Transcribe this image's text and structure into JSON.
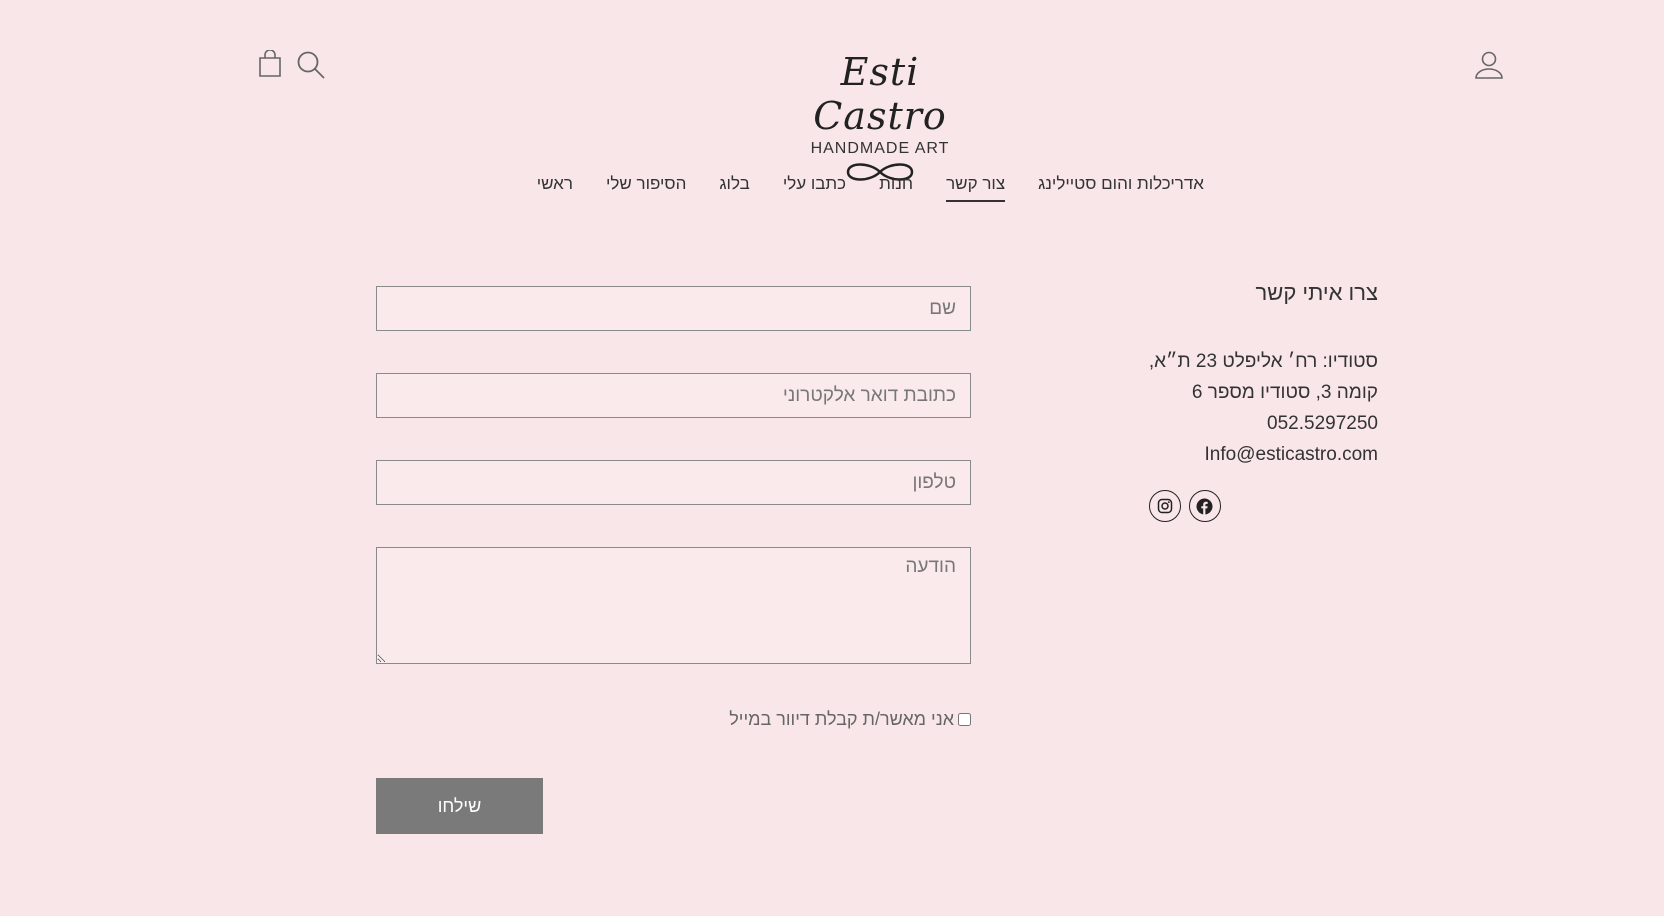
{
  "header": {
    "logo_title": "Esti Castro",
    "logo_subtitle": "HANDMADE ART",
    "icons": [
      "cart-icon",
      "search-icon",
      "account-icon"
    ]
  },
  "nav": {
    "items": [
      {
        "label": "ראשי"
      },
      {
        "label": "הסיפור שלי"
      },
      {
        "label": "בלוג"
      },
      {
        "label": "כתבו עלי"
      },
      {
        "label": "חנות"
      },
      {
        "label": "צור קשר",
        "active": true
      },
      {
        "label": "אדריכלות והום סטיילינג"
      }
    ]
  },
  "form": {
    "name_placeholder": "שם",
    "email_placeholder": "כתובת דואר אלקטרוני",
    "phone_placeholder": "טלפון",
    "message_placeholder": "הודעה",
    "consent_label": "אני מאשר/ת קבלת דיוור במייל",
    "submit_label": "שילחו"
  },
  "contact": {
    "heading": "צרו איתי קשר",
    "address_line1": "סטודיו: רח׳ אליפלט 23 ת״א,",
    "address_line2": "קומה 3, סטודיו מספר 6",
    "phone": "052.5297250",
    "email": "Info@esticastro.com",
    "social": [
      "instagram-icon",
      "facebook-icon"
    ]
  },
  "colors": {
    "background": "#f9e6e8",
    "button": "#7a7a7a",
    "text": "#333333"
  }
}
